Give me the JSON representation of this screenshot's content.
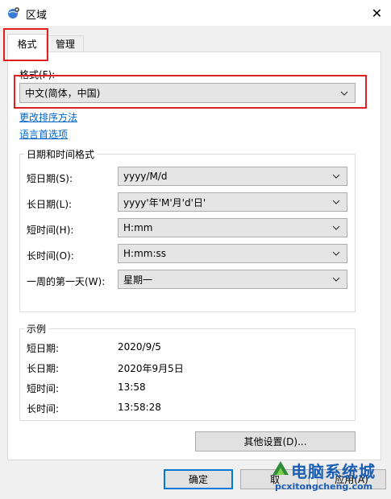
{
  "window": {
    "title": "区域",
    "close_glyph": "✕"
  },
  "tabs": [
    {
      "label": "格式"
    },
    {
      "label": "管理"
    }
  ],
  "format": {
    "label": "格式(F):",
    "value": "中文(简体，中国)",
    "link_sort": "更改排序方法",
    "link_lang": "语言首选项"
  },
  "datetime": {
    "group_title": "日期和时间格式",
    "rows": [
      {
        "label": "短日期(S):",
        "value": "yyyy/M/d"
      },
      {
        "label": "长日期(L):",
        "value": "yyyy'年'M'月'd'日'"
      },
      {
        "label": "短时间(H):",
        "value": "H:mm"
      },
      {
        "label": "长时间(O):",
        "value": "H:mm:ss"
      },
      {
        "label": "一周的第一天(W):",
        "value": "星期一"
      }
    ]
  },
  "example": {
    "group_title": "示例",
    "rows": [
      {
        "label": "短日期:",
        "value": "2020/9/5"
      },
      {
        "label": "长日期:",
        "value": "2020年9月5日"
      },
      {
        "label": "短时间:",
        "value": "13:58"
      },
      {
        "label": "长时间:",
        "value": "13:58:28"
      }
    ]
  },
  "buttons": {
    "other_settings": "其他设置(D)...",
    "ok": "确定",
    "cancel": "取",
    "apply": "应用(A)"
  },
  "watermark": {
    "line1": "电脑系统城",
    "line2": "pcxitongcheng.com"
  },
  "colors": {
    "highlight": "#e02020",
    "link": "#0066cc",
    "default_button_border": "#0078d7"
  },
  "icons": {
    "app": "globe-gear-icon",
    "combo": "chevron-down-icon"
  }
}
